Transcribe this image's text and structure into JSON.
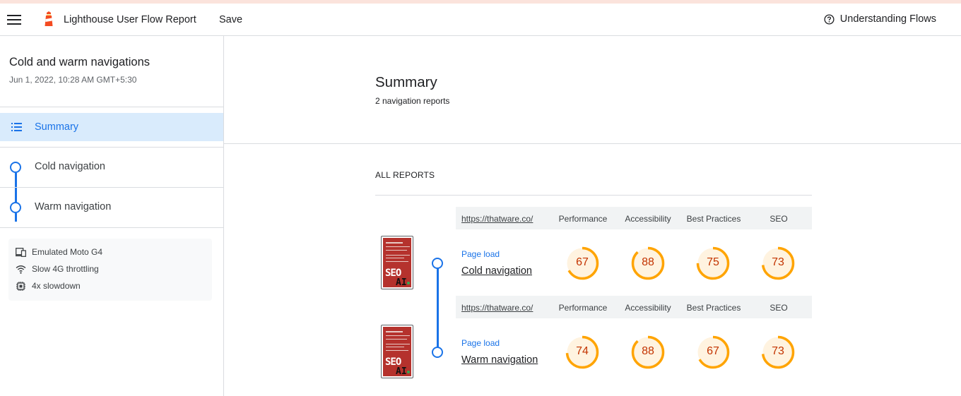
{
  "app": {
    "title": "Lighthouse User Flow Report",
    "save_label": "Save",
    "help_label": "Understanding Flows"
  },
  "sidebar": {
    "flow_title": "Cold and warm navigations",
    "flow_date": "Jun 1, 2022, 10:28 AM GMT+5:30",
    "summary_label": "Summary",
    "nav_items": [
      {
        "label": "Cold navigation"
      },
      {
        "label": "Warm navigation"
      }
    ],
    "environment": [
      {
        "icon": "device-icon",
        "label": "Emulated Moto G4"
      },
      {
        "icon": "wifi-icon",
        "label": "Slow 4G throttling"
      },
      {
        "icon": "cpu-icon",
        "label": "4x slowdown"
      }
    ]
  },
  "summary": {
    "title": "Summary",
    "subtitle": "2 navigation reports",
    "all_reports_label": "ALL REPORTS"
  },
  "categories": [
    "Performance",
    "Accessibility",
    "Best Practices",
    "SEO"
  ],
  "reports": [
    {
      "url": "https://thatware.co/",
      "step_type": "Page load",
      "name": "Cold navigation",
      "scores": [
        67,
        88,
        75,
        73
      ],
      "thumbnail_text_1": "SEO",
      "thumbnail_text_2": "AI"
    },
    {
      "url": "https://thatware.co/",
      "step_type": "Page load",
      "name": "Warm navigation",
      "scores": [
        74,
        88,
        67,
        73
      ],
      "thumbnail_text_1": "SEO",
      "thumbnail_text_2": "AI"
    }
  ],
  "colors": {
    "accent": "#1a73e8",
    "gauge_average": "#ffa400",
    "gauge_average_text": "#c33300",
    "gauge_average_fill": "#fff3e0"
  }
}
